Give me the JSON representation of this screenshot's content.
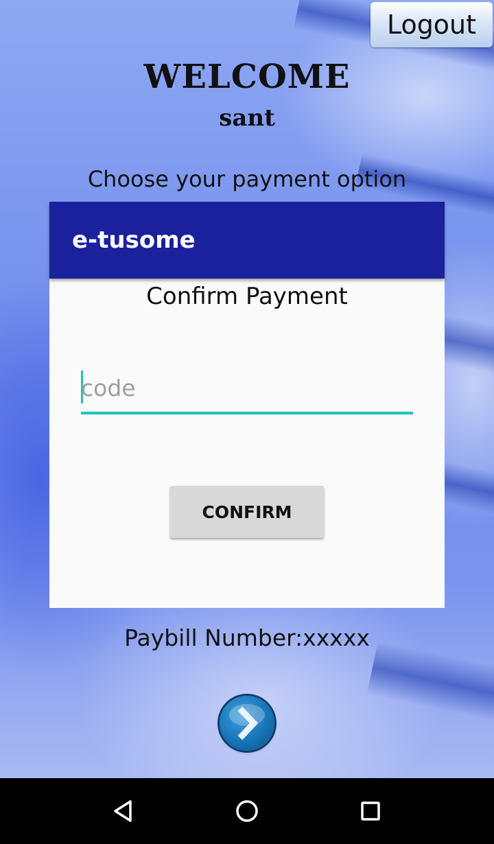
{
  "header": {
    "logout_label": "Logout",
    "welcome_text": "WELCOME",
    "username": "sant"
  },
  "main": {
    "prompt": "Choose your payment option",
    "card": {
      "title": "e-tusome",
      "heading": "Confirm Payment",
      "code_field": {
        "placeholder": "code",
        "value": ""
      },
      "confirm_label": "CONFIRM"
    },
    "paybill_text": "Paybill Number:xxxxx",
    "next_button_icon": "chevron-right-icon"
  },
  "navbar": {
    "icons": [
      "back-icon",
      "home-icon",
      "recents-icon"
    ]
  },
  "colors": {
    "card_header": "#1a219c",
    "field_accent": "#1fc4b8",
    "button_bg": "#d8d8d8",
    "next_button": "#1874b8"
  }
}
